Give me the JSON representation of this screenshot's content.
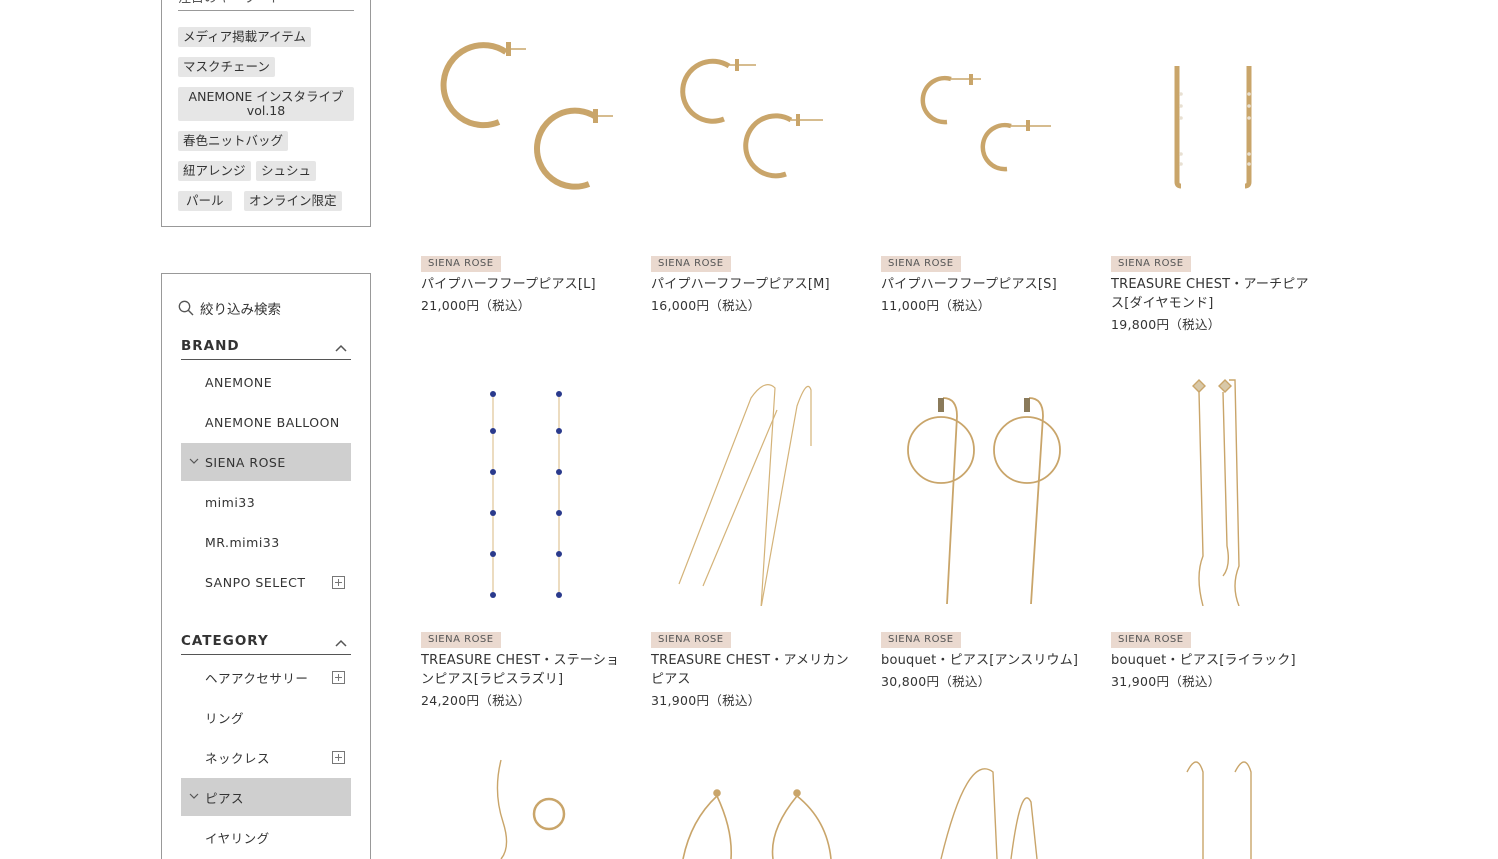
{
  "keywords": {
    "title": "注目のキーワード",
    "tags": [
      "メディア掲載アイテム",
      "マスクチェーン",
      "ANEMONE インスタライブ vol.18",
      "春色ニットバッグ",
      "紐アレンジ",
      "シュシュ",
      "パール",
      "オンライン限定"
    ]
  },
  "filter": {
    "title": "絞り込み検索",
    "brand": {
      "title": "BRAND",
      "items": [
        {
          "label": "ANEMONE",
          "active": false,
          "expandable": false
        },
        {
          "label": "ANEMONE BALLOON",
          "active": false,
          "expandable": false
        },
        {
          "label": "SIENA ROSE",
          "active": true,
          "expandable": false
        },
        {
          "label": "mimi33",
          "active": false,
          "expandable": false
        },
        {
          "label": "MR.mimi33",
          "active": false,
          "expandable": false
        },
        {
          "label": "SANPO SELECT",
          "active": false,
          "expandable": true
        }
      ]
    },
    "category": {
      "title": "CATEGORY",
      "items": [
        {
          "label": "ヘアアクセサリー",
          "active": false,
          "expandable": true
        },
        {
          "label": "リング",
          "active": false,
          "expandable": false
        },
        {
          "label": "ネックレス",
          "active": false,
          "expandable": true
        },
        {
          "label": "ピアス",
          "active": true,
          "expandable": false
        },
        {
          "label": "イヤリング",
          "active": false,
          "expandable": false
        }
      ]
    }
  },
  "products": [
    {
      "brand": "SIENA ROSE",
      "name": "パイプハーフフープピアス[L]",
      "price": "21,000円（税込）",
      "image": "hoop-earrings-large"
    },
    {
      "brand": "SIENA ROSE",
      "name": "パイプハーフフープピアス[M]",
      "price": "16,000円（税込）",
      "image": "hoop-earrings-medium"
    },
    {
      "brand": "SIENA ROSE",
      "name": "パイプハーフフープピアス[S]",
      "price": "11,000円（税込）",
      "image": "hoop-earrings-small"
    },
    {
      "brand": "SIENA ROSE",
      "name": "TREASURE CHEST・アーチピアス[ダイヤモンド]",
      "price": "19,800円（税込）",
      "image": "arch-earrings"
    },
    {
      "brand": "SIENA ROSE",
      "name": "TREASURE CHEST・ステーションピアス[ラピスラズリ]",
      "price": "24,200円（税込）",
      "image": "station-earrings"
    },
    {
      "brand": "SIENA ROSE",
      "name": "TREASURE CHEST・アメリカンピアス",
      "price": "31,900円（税込）",
      "image": "american-earrings"
    },
    {
      "brand": "SIENA ROSE",
      "name": "bouquet・ピアス[アンスリウム]",
      "price": "30,800円（税込）",
      "image": "ring-drop-earrings"
    },
    {
      "brand": "SIENA ROSE",
      "name": "bouquet・ピアス[ライラック]",
      "price": "31,900円（税込）",
      "image": "wave-drop-earrings"
    },
    {
      "brand": "",
      "name": "",
      "price": "",
      "image": "wave-ear-cuff"
    },
    {
      "brand": "",
      "name": "",
      "price": "",
      "image": "wavy-loop-earrings"
    },
    {
      "brand": "",
      "name": "",
      "price": "",
      "image": "chain-threader-earrings"
    },
    {
      "brand": "",
      "name": "",
      "price": "",
      "image": "hook-drop-earrings"
    }
  ],
  "colors": {
    "gold": "#c9a56a",
    "lapis": "#2a3a8c",
    "badge": "#ead9cf",
    "active": "#cfcfcf"
  }
}
